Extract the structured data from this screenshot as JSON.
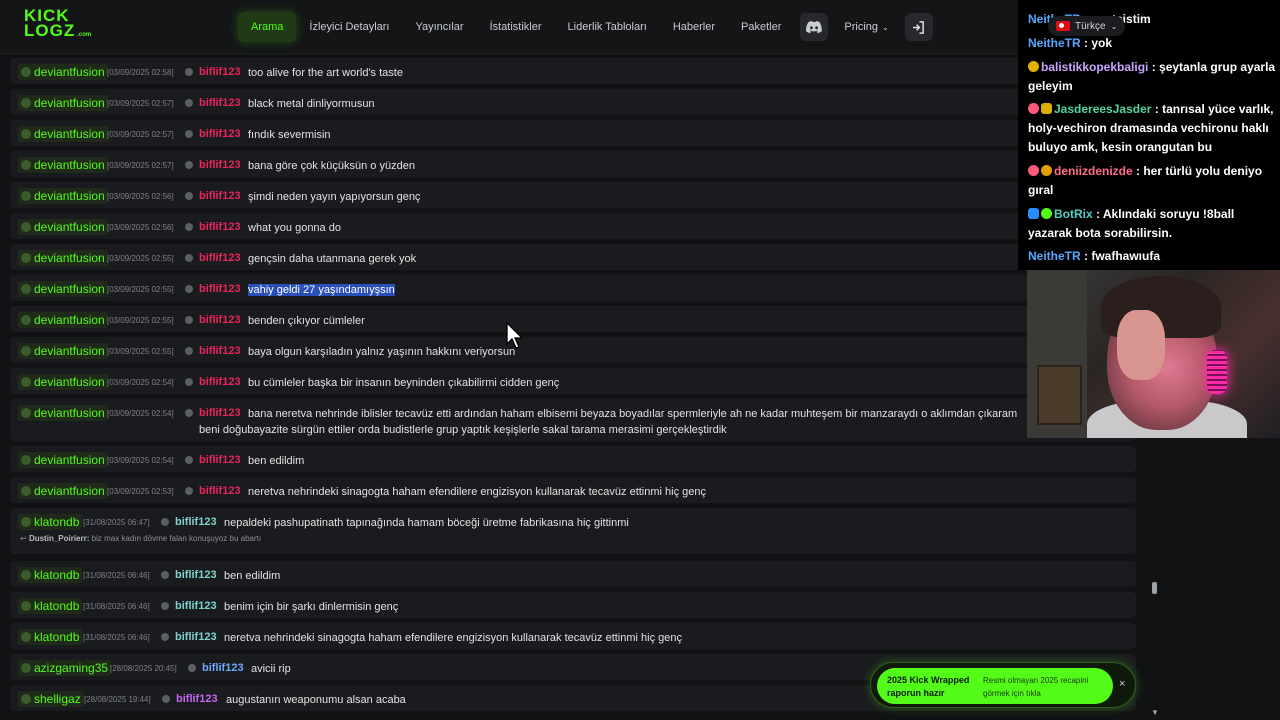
{
  "nav": {
    "logo_line1": "KICK",
    "logo_line2": "LOGZ",
    "logo_suffix": ".com",
    "links": [
      "Arama",
      "İzleyici Detayları",
      "Yayıncılar",
      "İstatistikler",
      "Liderlik Tabloları",
      "Haberler",
      "Paketler"
    ],
    "pricing": "Pricing"
  },
  "language": "Türkçe",
  "rows": [
    {
      "user": "deviantfusion",
      "ts": "[03/09/2025 02:58]",
      "target": "biflif123",
      "msg": "too alive for the art world's taste"
    },
    {
      "user": "deviantfusion",
      "ts": "[03/09/2025 02:57]",
      "target": "biflif123",
      "msg": "black metal dinliyormusun"
    },
    {
      "user": "deviantfusion",
      "ts": "[03/09/2025 02:57]",
      "target": "biflif123",
      "msg": "fındık severmisin"
    },
    {
      "user": "deviantfusion",
      "ts": "[03/09/2025 02:57]",
      "target": "biflif123",
      "msg": "bana göre çok küçüksün o yüzden"
    },
    {
      "user": "deviantfusion",
      "ts": "[03/09/2025 02:56]",
      "target": "biflif123",
      "msg": "şimdi neden yayın yapıyorsun genç"
    },
    {
      "user": "deviantfusion",
      "ts": "[03/09/2025 02:56]",
      "target": "biflif123",
      "msg": "what you gonna do"
    },
    {
      "user": "deviantfusion",
      "ts": "[03/09/2025 02:55]",
      "target": "biflif123",
      "msg": "gençsin daha utanmana gerek yok"
    },
    {
      "user": "deviantfusion",
      "ts": "[03/09/2025 02:55]",
      "target": "biflif123",
      "msg": "vahiy geldi 27 yaşındamıyşsın"
    },
    {
      "user": "deviantfusion",
      "ts": "[03/09/2025 02:55]",
      "target": "biflif123",
      "msg": "benden çıkıyor cümleler"
    },
    {
      "user": "deviantfusion",
      "ts": "[03/09/2025 02:55]",
      "target": "biflif123",
      "msg": "baya olgun karşıladın yalnız yaşının hakkını veriyorsun"
    },
    {
      "user": "deviantfusion",
      "ts": "[03/09/2025 02:54]",
      "target": "biflif123",
      "msg": "bu cümleler başka bir insanın beyninden çıkabilirmi cidden genç"
    },
    {
      "user": "deviantfusion",
      "ts": "[03/09/2025 02:54]",
      "target": "biflif123",
      "msg": "bana neretva nehrinde iblisler tecavüz etti ardından haham elbisemi beyaza boyadılar spermleriyle ah ne kadar muhteşem bir manzaraydı o aklımdan çıkaram",
      "msg2": "beni doğubayazite sürgün ettiler orda budistlerle grup yaptık keşişlerle sakal tarama merasimi gerçekleştirdik"
    },
    {
      "user": "deviantfusion",
      "ts": "[03/09/2025 02:54]",
      "target": "biflif123",
      "msg": "ben edildim"
    },
    {
      "user": "deviantfusion",
      "ts": "[03/09/2025 02:53]",
      "target": "biflif123",
      "msg": "neretva nehrindeki sinagogta haham efendilere engizisyon kullanarak tecavüz ettinmi hiç genç"
    },
    {
      "user": "klatondb",
      "ts": "[31/08/2025 06:47]",
      "target": "biflif123",
      "msg": "nepaldeki pashupatinath tapınağında hamam böceği üretme fabrikasına hiç gittinmi",
      "reply_user": "Dustin_Poirierr:",
      "reply_text": "biz max kadın dövme falan konuşuyoz bu abartı"
    },
    {
      "user": "klatondb",
      "ts": "[31/08/2025 06:46]",
      "target": "biflif123",
      "msg": "ben edildim"
    },
    {
      "user": "klatondb",
      "ts": "[31/08/2025 06:46]",
      "target": "biflif123",
      "msg": "benim için bir şarkı dinlermisin genç"
    },
    {
      "user": "klatondb",
      "ts": "[31/08/2025 06:46]",
      "target": "biflif123",
      "msg": "neretva nehrindeki sinagogta haham efendilere engizisyon kullanarak tecavüz ettinmi hiç genç"
    },
    {
      "user": "azizgaming35",
      "ts": "[28/08/2025 20:45]",
      "target": "biflif123",
      "msg": "avicii rip"
    },
    {
      "user": "shelligaz",
      "ts": "[28/08/2025 19:44]",
      "target": "biflif123",
      "msg": "augustanın weaponumu alsan acaba"
    }
  ],
  "toast": {
    "title": "2025 Kick Wrapped raporun hazır",
    "body": "Resmi olmayan 2025 recapini görmek için tıkla",
    "close": "×"
  },
  "overlay_chat": [
    {
      "user": "NeitheTR",
      "text": " : apateistim"
    },
    {
      "user": "NeitheTR",
      "text": " : yok"
    },
    {
      "user": "balistikkopekbaligi",
      "text": " : şeytanla grup ayarla geleyim"
    },
    {
      "user": "JasdereesJasder",
      "text": " : tanrısal yüce varlık, holy-vechiron dramasında vechironu haklı buluyo amk, kesin orangutan bu"
    },
    {
      "user": "deniizdenizde",
      "text": " : her türlü yolu deniyo gıral"
    },
    {
      "user": "BotRix",
      "text": " : Aklındaki soruyu !8ball yazarak bota sorabilirsin."
    },
    {
      "user": "NeitheTR",
      "text": " : fwafhawıufa"
    }
  ],
  "colors": {
    "accent": "#53fc18",
    "target_red": "#e8255c",
    "highlight": "#2b4fb8"
  }
}
